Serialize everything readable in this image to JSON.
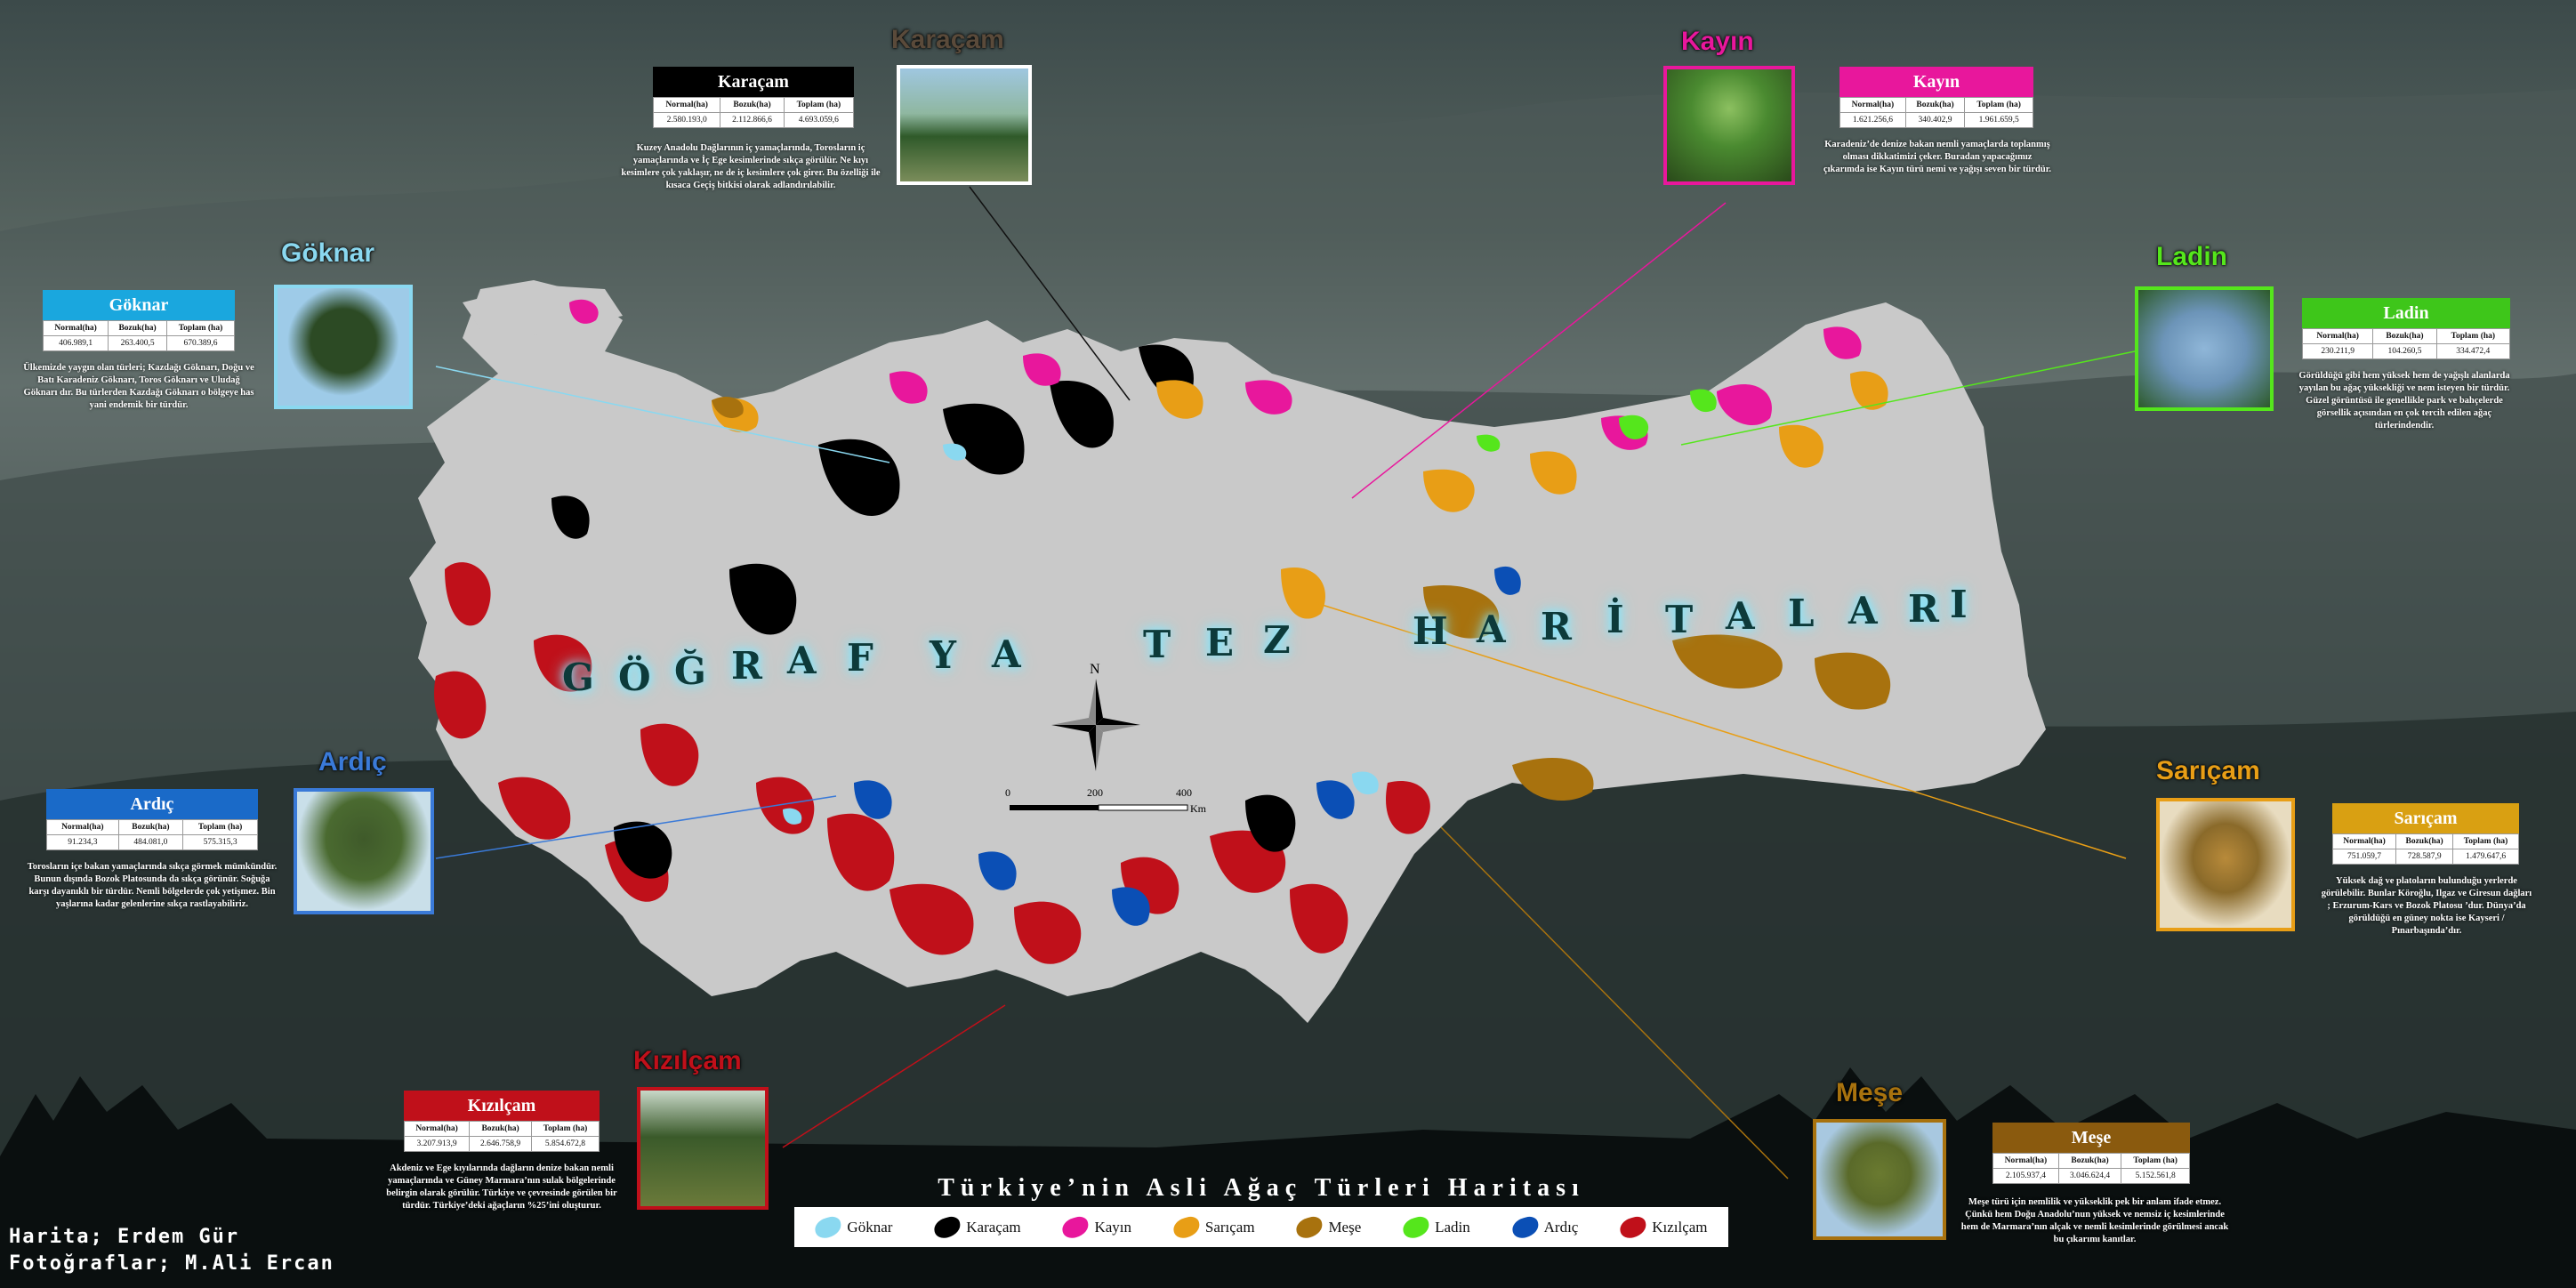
{
  "colors": {
    "goknar": "#8ad8f0",
    "karacam": "#000000",
    "kayin": "#e8179c",
    "saricam": "#e89e16",
    "mese": "#a8720e",
    "ladin": "#55e61c",
    "ardic": "#0b4fb5",
    "kizilcam": "#c0101a",
    "land": "#c9c9c9"
  },
  "map": {
    "words": [
      "G",
      "Ö",
      "Ğ",
      "R",
      "A",
      "F",
      "Y",
      "A",
      "T",
      "E",
      "Z",
      "H",
      "A",
      "R",
      "İ",
      "T",
      "A",
      "L",
      "A",
      "R",
      "I"
    ],
    "north": "N",
    "scale": [
      "0",
      "200",
      "400"
    ],
    "scale_unit": "Km"
  },
  "title": "Türkiye’nin Asli Ağaç Türleri Haritası",
  "legend": [
    {
      "name": "Göknar",
      "icon": "goknar-blob"
    },
    {
      "name": "Karaçam",
      "icon": "karacam-blob"
    },
    {
      "name": "Kayın",
      "icon": "kayin-blob"
    },
    {
      "name": "Sarıçam",
      "icon": "saricam-blob"
    },
    {
      "name": "Meşe",
      "icon": "mese-blob"
    },
    {
      "name": "Ladin",
      "icon": "ladin-blob"
    },
    {
      "name": "Ardıç",
      "icon": "ardic-blob"
    },
    {
      "name": "Kızılçam",
      "icon": "kizilcam-blob"
    }
  ],
  "credits": {
    "line1": "Harita; Erdem Gür",
    "line2": "Fotoğraflar; M.Ali Ercan"
  },
  "table_headers": [
    "Normal(ha)",
    "Bozuk(ha)",
    "Toplam (ha)"
  ],
  "species": {
    "karacam": {
      "photo_title": "Karaçam",
      "name": "Karaçam",
      "normal": "2.580.193,0",
      "bozuk": "2.112.866,6",
      "toplam": "4.693.059,6",
      "desc": "Kuzey Anadolu Dağlarının iç yamaçlarında, Torosların iç yamaçlarında ve İç Ege kesimlerinde sıkça görülür. Ne kıyı kesimlere çok yaklaşır, ne de iç kesimlere çok girer. Bu özelliği ile kısaca Geçiş bitkisi olarak adlandırılabilir."
    },
    "kayin": {
      "photo_title": "Kayın",
      "name": "Kayın",
      "normal": "1.621.256,6",
      "bozuk": "340.402,9",
      "toplam": "1.961.659,5",
      "desc": "Karadeniz’de denize bakan nemli yamaçlarda toplanmış olması dikkatimizi çeker. Buradan yapacağımız çıkarımda ise Kayın türü nemi ve yağışı seven bir türdür."
    },
    "goknar": {
      "photo_title": "Göknar",
      "name": "Göknar",
      "normal": "406.989,1",
      "bozuk": "263.400,5",
      "toplam": "670.389,6",
      "desc": "Ülkemizde yaygın olan türleri; Kazdağı Göknarı, Doğu ve Batı Karadeniz Göknarı, Toros Göknarı ve Uludağ Göknarı dır. Bu türlerden Kazdağı Göknarı o bölgeye has yani endemik bir türdür."
    },
    "ladin": {
      "photo_title": "Ladin",
      "name": "Ladin",
      "normal": "230.211,9",
      "bozuk": "104.260,5",
      "toplam": "334.472,4",
      "desc": "Görüldüğü gibi hem yüksek hem de yağışlı alanlarda yayılan bu ağaç yüksekliği ve nem isteyen bir türdür. Güzel görüntüsü ile genellikle park ve bahçelerde görsellik açısından en çok tercih edilen ağaç türlerindendir."
    },
    "ardic": {
      "photo_title": "Ardıç",
      "name": "Ardıç",
      "normal": "91.234,3",
      "bozuk": "484.081,0",
      "toplam": "575.315,3",
      "desc": "Torosların içe bakan yamaçlarında sıkça görmek mümkündür. Bunun dışında Bozok Platosunda da sıkça görünür. Soğuğa karşı dayanıklı bir türdür. Nemli bölgelerde çok yetişmez. Bin yaşlarına kadar gelenlerine sıkça rastlayabiliriz."
    },
    "saricam": {
      "photo_title": "Sarıçam",
      "name": "Sarıçam",
      "normal": "751.059,7",
      "bozuk": "728.587,9",
      "toplam": "1.479.647,6",
      "desc": "Yüksek dağ ve platoların bulunduğu yerlerde görülebilir. Bunlar Köroğlu, Ilgaz ve Giresun dağları ; Erzurum-Kars ve Bozok Platosu ’dur. Dünya’da görüldüğü en güney nokta ise Kayseri / Pınarbaşında’dır."
    },
    "kizilcam": {
      "photo_title": "Kızılçam",
      "name": "Kızılçam",
      "normal": "3.207.913,9",
      "bozuk": "2.646.758,9",
      "toplam": "5.854.672,8",
      "desc": "Akdeniz ve Ege kıyılarında dağların denize bakan nemli yamaçlarında ve Güney Marmara’nın sulak bölgelerinde belirgin olarak görülür. Türkiye ve çevresinde görülen bir türdür. Türkiye’deki ağaçların %25’ini oluşturur."
    },
    "mese": {
      "photo_title": "Meşe",
      "name": "Meşe",
      "normal": "2.105.937,4",
      "bozuk": "3.046.624,4",
      "toplam": "5.152.561,8",
      "desc": "Meşe türü için nemlilik ve yükseklik pek bir anlam ifade etmez. Çünkü hem Doğu Anadolu’nun yüksek ve nemsiz iç kesimlerinde hem de Marmara’nın alçak ve nemli kesimlerinde görülmesi ancak bu çıkarımı kanıtlar."
    }
  }
}
